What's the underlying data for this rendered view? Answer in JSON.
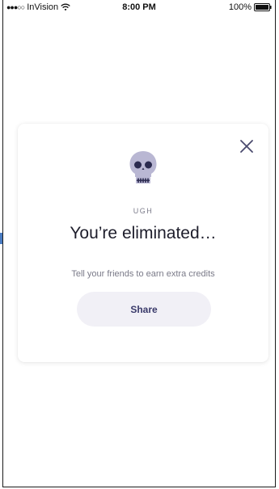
{
  "status_bar": {
    "signal": "●●●○○",
    "carrier": "InVision",
    "time": "8:00 PM",
    "battery_label": "100%"
  },
  "modal": {
    "eyebrow": "UGH",
    "title": "You’re eliminated…",
    "subtitle": "Tell your friends to earn extra credits",
    "share_label": "Share",
    "icon": "skull-icon",
    "close_icon": "close-icon",
    "accent_color": "#6c6c9a"
  }
}
